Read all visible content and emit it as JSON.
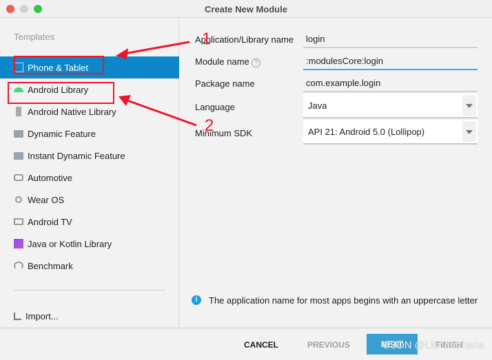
{
  "window": {
    "title": "Create New Module"
  },
  "sidebar": {
    "header": "Templates",
    "items": [
      {
        "label": "Phone & Tablet",
        "icon": "phone-tablet-icon",
        "selected": true
      },
      {
        "label": "Android Library",
        "icon": "android-icon"
      },
      {
        "label": "Android Native Library",
        "icon": "native-library-icon"
      },
      {
        "label": "Dynamic Feature",
        "icon": "folder-icon"
      },
      {
        "label": "Instant Dynamic Feature",
        "icon": "folder-icon"
      },
      {
        "label": "Automotive",
        "icon": "car-icon"
      },
      {
        "label": "Wear OS",
        "icon": "watch-icon"
      },
      {
        "label": "Android TV",
        "icon": "tv-icon"
      },
      {
        "label": "Java or Kotlin Library",
        "icon": "kotlin-icon"
      },
      {
        "label": "Benchmark",
        "icon": "gauge-icon"
      }
    ],
    "import": "Import..."
  },
  "form": {
    "app_name_label": "Application/Library name",
    "app_name": "login",
    "module_label": "Module name",
    "module": ":modulesCore:login",
    "package_label": "Package name",
    "package": "com.example.login",
    "language_label": "Language",
    "language": "Java",
    "sdk_label": "Minimum SDK",
    "sdk": "API 21: Android 5.0 (Lollipop)"
  },
  "info": "The application name for most apps begins with an uppercase letter",
  "buttons": {
    "cancel": "CANCEL",
    "previous": "PREVIOUS",
    "next": "NEXT",
    "finish": "FINISH"
  },
  "annotations": {
    "one": "1",
    "two": "2",
    "color": "#f0142a"
  },
  "watermark": "CSDN @Liknanahana",
  "colors": {
    "selection": "#0d87c9",
    "focus": "#3fa9f2",
    "next": "#3c9fd4"
  }
}
